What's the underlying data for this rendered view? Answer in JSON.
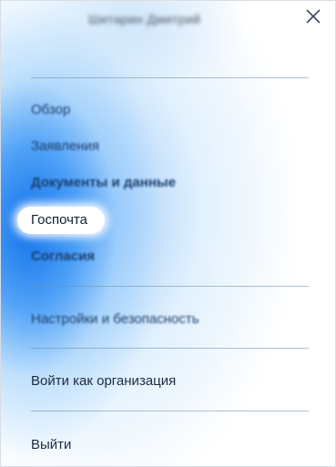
{
  "user": {
    "name": "Шитарин Дмитрий"
  },
  "close_label": "×",
  "menu": {
    "overview": "Обзор",
    "applications": "Заявления",
    "documents": "Документы и данные",
    "gosmail": "Госпочта",
    "consents": "Согласия",
    "settings": "Настройки и безопасность",
    "login_org": "Войти как организация",
    "logout": "Выйти"
  },
  "colors": {
    "accent_blue": "#1672e6",
    "text": "#1e2a44"
  },
  "icons": {
    "close": "close-icon"
  }
}
